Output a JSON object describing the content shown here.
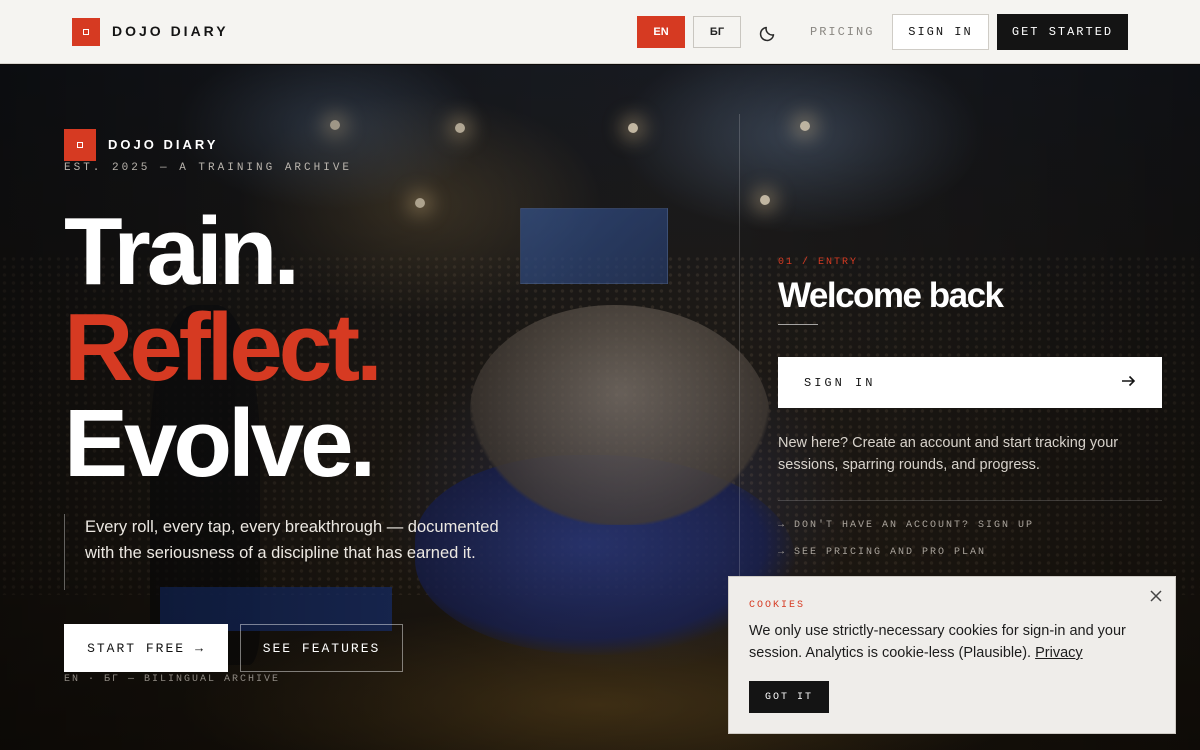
{
  "nav": {
    "brand": "DOJO DIARY",
    "lang_active": "ЕN",
    "lang_inactive": "БГ",
    "theme_icon": "moon-icon",
    "pricing": "PRICING",
    "sign_in": "SIGN IN",
    "get_started": "GET STARTED"
  },
  "hero": {
    "brand": "DOJO DIARY",
    "established": "EST. 2025 — A TRAINING ARCHIVE",
    "headline": [
      "Train.",
      "Reflect.",
      "Evolve."
    ],
    "lead": "Every roll, every tap, every breakthrough — documented with the seriousness of a discipline that has earned it.",
    "start_free": "START FREE",
    "start_free_arrow": "→",
    "see_features": "SEE FEATURES",
    "language_note": "EN · БГ — BILINGUAL ARCHIVE"
  },
  "panel": {
    "eyebrow": "01 / ENTRY",
    "title": "Welcome back",
    "sign_in": "SIGN IN",
    "sign_in_arrow": "→",
    "description": "New here? Create an account and start tracking your sessions, sparring rounds, and progress.",
    "signup_link": "→ DON'T HAVE AN ACCOUNT? SIGN UP",
    "pricing_link": "→ SEE PRICING AND PRO PLAN"
  },
  "cookie": {
    "title": "COOKIES",
    "text": "We only use strictly-necessary cookies for sign-in and your session. Analytics is cookie-less (Plausible).",
    "privacy_link": "Privacy",
    "accept": "GOT IT",
    "close_icon": "close-icon"
  },
  "colors": {
    "accent": "#d63a22",
    "dark": "#141414",
    "nav_bg": "#f5f4f1"
  }
}
